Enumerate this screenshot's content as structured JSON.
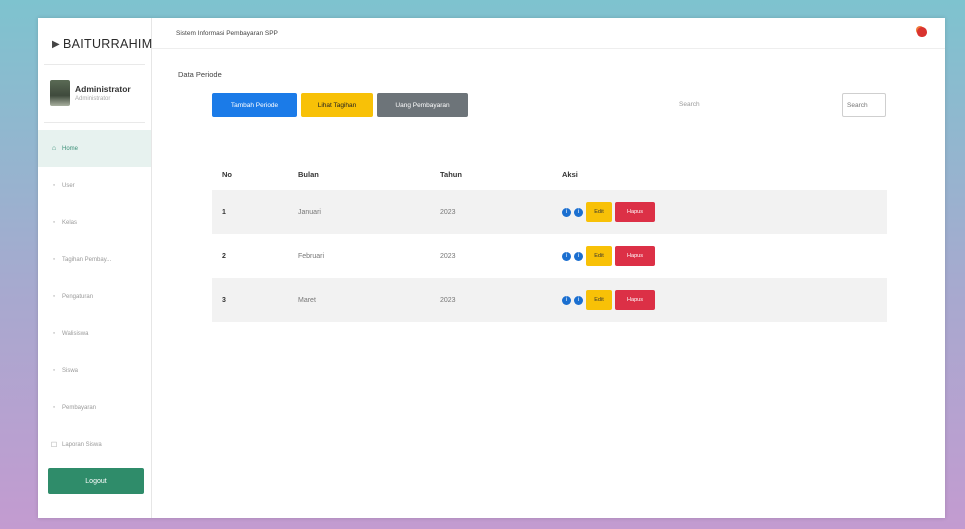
{
  "brand": "BAITURRAHIM",
  "profile": {
    "name": "Administrator",
    "role": "Administrator"
  },
  "nav": [
    {
      "icon": "⌂",
      "label": "Home",
      "active": true
    },
    {
      "icon": "◦",
      "label": "User"
    },
    {
      "icon": "◦",
      "label": "Kelas"
    },
    {
      "icon": "◦",
      "label": "Tagihan Pembay..."
    },
    {
      "icon": "◦",
      "label": "Pengaturan"
    },
    {
      "icon": "◦",
      "label": "Walisiswa"
    },
    {
      "icon": "◦",
      "label": "Siswa"
    },
    {
      "icon": "◦",
      "label": "Pembayaran"
    },
    {
      "icon": "☐",
      "label": "Laporan Siswa"
    }
  ],
  "logout_label": "Logout",
  "topbar": {
    "title": "Sistem Informasi Pembayaran SPP"
  },
  "main": {
    "section_title": "Data Periode",
    "buttons": {
      "add": "Tambah Periode",
      "view": "Lihat Tagihan",
      "payment": "Uang Pembayaran"
    },
    "search_label": "Search",
    "search_placeholder": "Search"
  },
  "table": {
    "headers": {
      "no": "No",
      "bulan": "Bulan",
      "tahun": "Tahun",
      "aksi": "Aksi"
    },
    "rows": [
      {
        "no": "1",
        "bulan": "Januari",
        "tahun": "2023"
      },
      {
        "no": "2",
        "bulan": "Februari",
        "tahun": "2023"
      },
      {
        "no": "3",
        "bulan": "Maret",
        "tahun": "2023"
      }
    ],
    "edit_label": "Edit",
    "hapus_label": "Hapus"
  },
  "colors": {
    "primary": "#1b7be8",
    "warning": "#f8c107",
    "secondary": "#6d7479",
    "danger": "#dc3046",
    "success": "#2f8c6a"
  }
}
